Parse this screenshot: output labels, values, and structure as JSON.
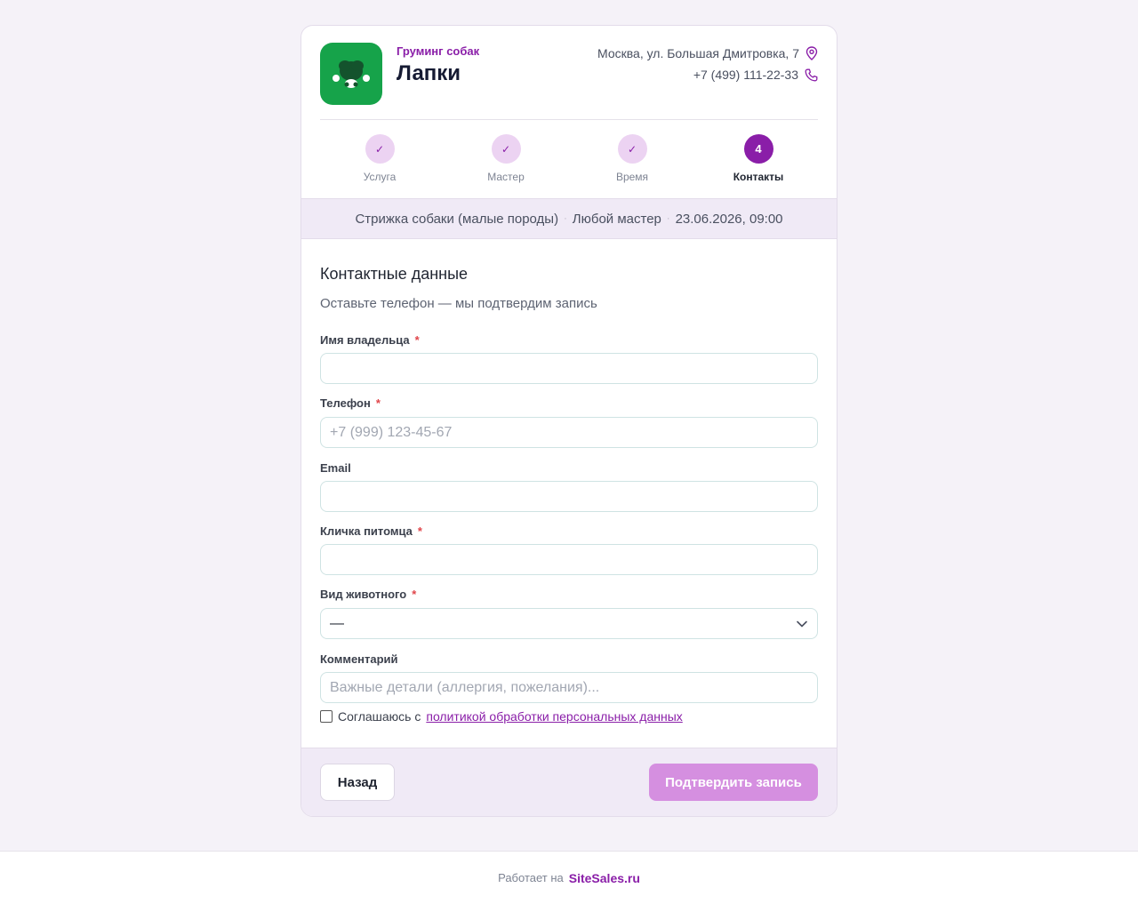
{
  "header": {
    "subtitle": "Груминг собак",
    "title": "Лапки",
    "address": "Москва, ул. Большая Дмитровка, 7",
    "phone": "+7 (499) 111-22-33"
  },
  "steps": [
    {
      "label": "Услуга",
      "state": "done"
    },
    {
      "label": "Мастер",
      "state": "done"
    },
    {
      "label": "Время",
      "state": "done"
    },
    {
      "label": "Контакты",
      "number": "4",
      "state": "active"
    }
  ],
  "summary": {
    "service": "Стрижка собаки (малые породы)",
    "master": "Любой мастер",
    "datetime": "23.06.2026, 09:00"
  },
  "form": {
    "title": "Контактные данные",
    "subtitle": "Оставьте телефон — мы подтвердим запись",
    "owner_label": "Имя владельца",
    "phone_label": "Телефон",
    "phone_placeholder": "+7 (999) 123-45-67",
    "email_label": "Email",
    "pet_label": "Кличка питомца",
    "species_label": "Вид животного",
    "species_value": "—",
    "comment_label": "Комментарий",
    "comment_placeholder": "Важные детали (аллергия, пожелания)...",
    "required_mark": "*",
    "agree_text": "Соглашаюсь с",
    "agree_link": "политикой обработки персональных данных"
  },
  "actions": {
    "back": "Назад",
    "confirm": "Подтвердить запись"
  },
  "footer": {
    "powered": "Работает на",
    "brand": "SiteSales.ru"
  },
  "colors": {
    "accent": "#8a1ea8",
    "logo_bg": "#16a34a",
    "confirm_bg": "#d58fe0"
  }
}
